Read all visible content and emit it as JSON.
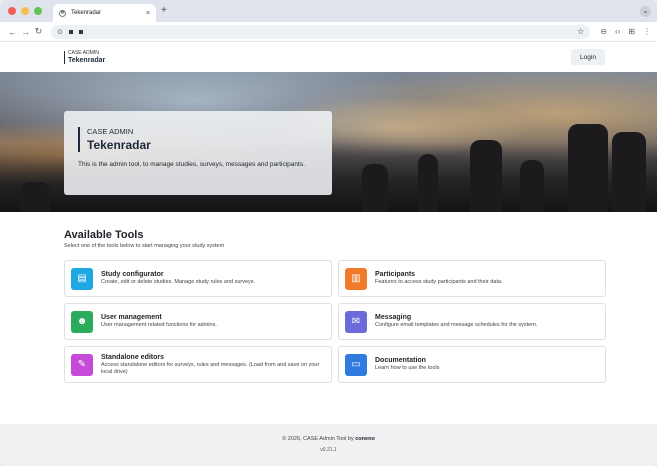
{
  "browser": {
    "tab_title": "Tekenradar",
    "tab_close": "×",
    "new_tab": "+",
    "favicon_glyph": "✲",
    "chevron": "⌄"
  },
  "app_header": {
    "brand_small": "CASE ADMIN",
    "brand_big": "Tekenradar",
    "login_label": "Login"
  },
  "hero": {
    "kicker": "CASE ADMIN",
    "title": "Tekenradar",
    "description": "This is the admin tool, to manage studies, surveys, messages and participants."
  },
  "tools": {
    "title": "Available Tools",
    "subtitle": "Select one of the tools below to start managing your study system",
    "items": [
      {
        "title": "Study configurator",
        "description": "Create, edit or delete studies. Manage study rules and surveys.",
        "icon": "document-icon",
        "color": "#1ea7e0"
      },
      {
        "title": "Participants",
        "description": "Features to access study participants and their data.",
        "icon": "clipboard-chart-icon",
        "color": "#f07a2a"
      },
      {
        "title": "User management",
        "description": "User management related functions for admins.",
        "icon": "user-gear-icon",
        "color": "#2bab5c"
      },
      {
        "title": "Messaging",
        "description": "Configure email templates and message schedules for the system.",
        "icon": "mail-gear-icon",
        "color": "#6a6bd8"
      },
      {
        "title": "Standalone editors",
        "description": "Access standalone editors for surveys, rules and messages. (Load from and save on your local drive)",
        "icon": "pencil-icon",
        "color": "#c54ad9"
      },
      {
        "title": "Documentation",
        "description": "Learn how to use the tools",
        "icon": "tablet-icon",
        "color": "#2f7be0"
      }
    ]
  },
  "footer": {
    "copyright_prefix": "© 2026, CASE Admin Tool by",
    "copyright_brand": "coneno",
    "version": "v0.21.1"
  },
  "colors": {
    "brand_dark": "#1e2a3a"
  }
}
